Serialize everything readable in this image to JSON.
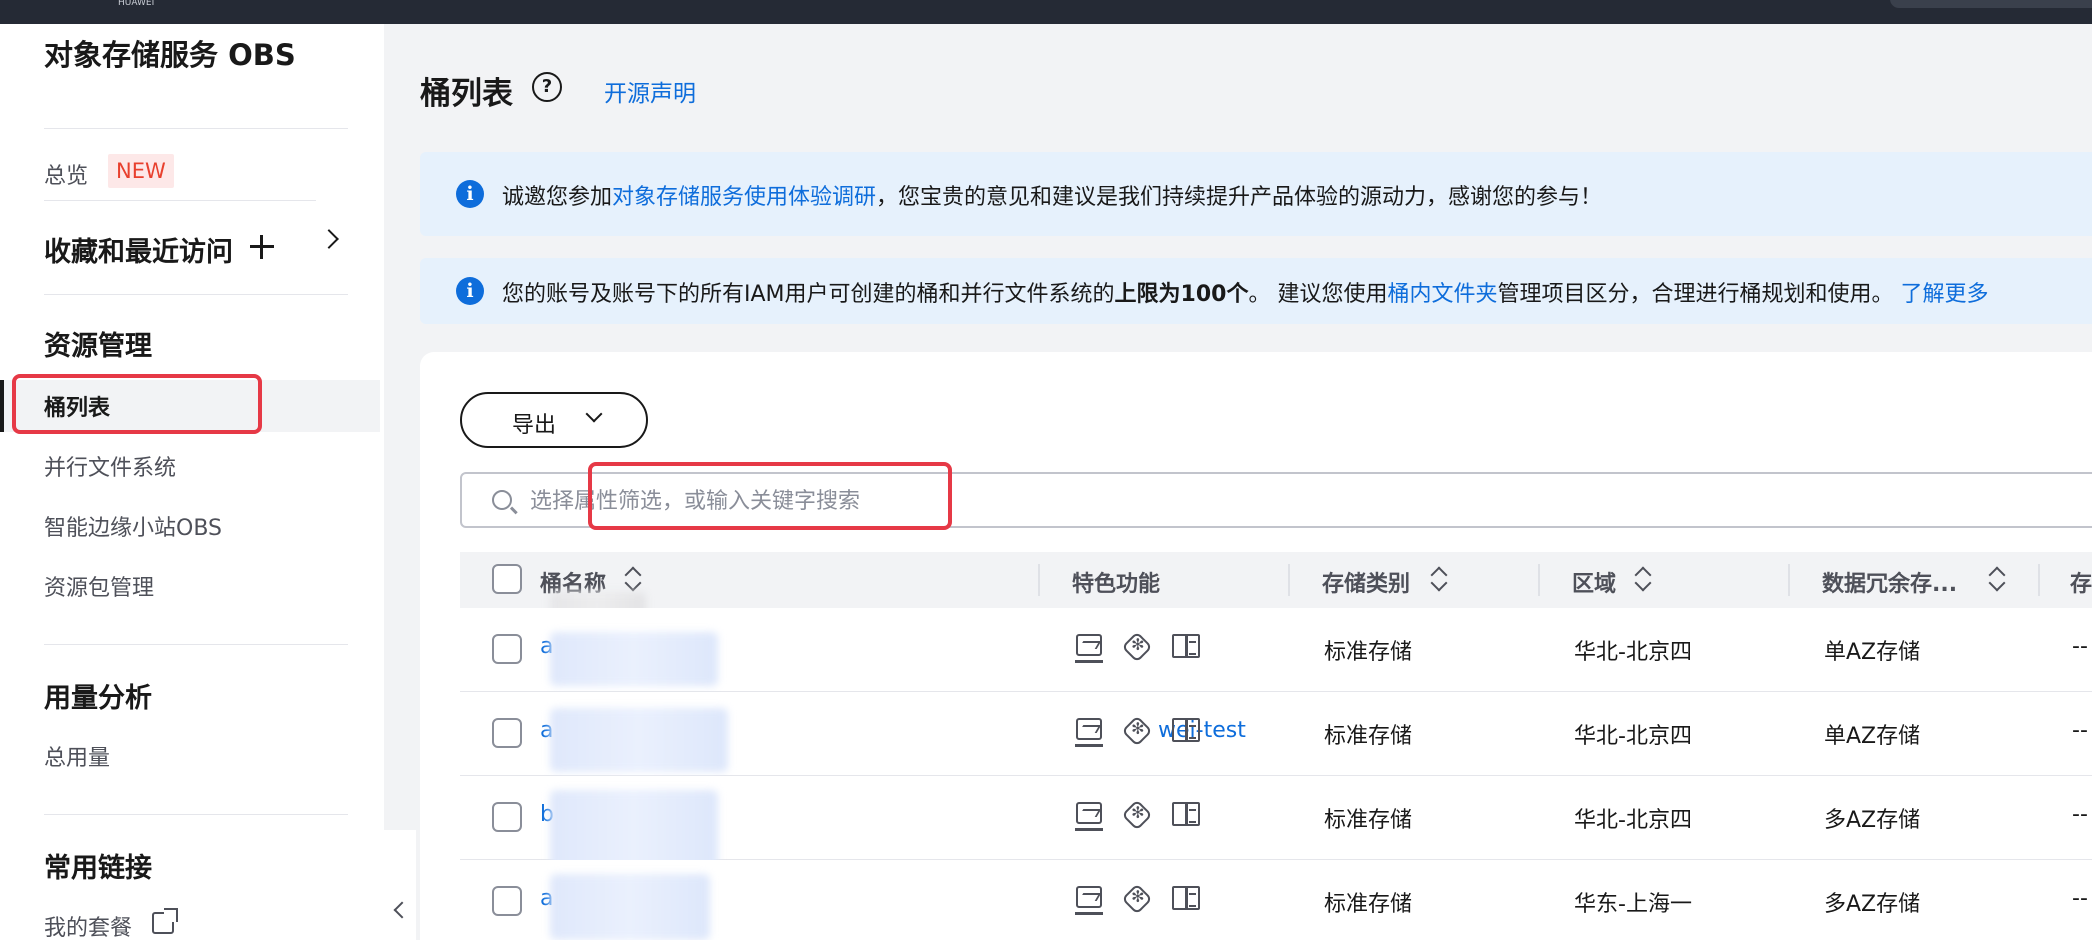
{
  "topbar": {
    "logo_text": "HUAWEI"
  },
  "sidebar": {
    "service_title": "对象存储服务 OBS",
    "overview": "总览",
    "overview_badge": "NEW",
    "favorites": "收藏和最近访问",
    "resource_section": "资源管理",
    "items": {
      "bucket_list": "桶列表",
      "parallel_fs": "并行文件系统",
      "edge_obs": "智能边缘小站OBS",
      "package_mgmt": "资源包管理"
    },
    "usage_section": "用量分析",
    "total_usage": "总用量",
    "links_section": "常用链接",
    "my_package": "我的套餐"
  },
  "main": {
    "title": "桶列表",
    "help_glyph": "?",
    "open_source_link": "开源声明"
  },
  "banners": [
    {
      "icon": "i",
      "pre": "诚邀您参加",
      "link": "对象存储服务使用体验调研",
      "post": "，您宝贵的意见和建议是我们持续提升产品体验的源动力，感谢您的参与！"
    },
    {
      "icon": "i",
      "pre": "您的账号及账号下的所有IAM用户可创建的桶和并行文件系统的",
      "bold": "上限为100个",
      "mid": "。 建议您使用",
      "link": "桶内文件夹",
      "post": "管理项目区分，合理进行桶规划和使用。",
      "link2": "了解更多"
    }
  ],
  "toolbar": {
    "export_label": "导出"
  },
  "search": {
    "placeholder": "选择属性筛选，或输入关键字搜索"
  },
  "table": {
    "headers": {
      "name": "桶名称",
      "features": "特色功能",
      "storage_class": "存储类别",
      "region": "区域",
      "redundancy": "数据冗余存...",
      "next": "存"
    },
    "rows": [
      {
        "name": "a",
        "storage_class": "标准存储",
        "region": "华北-北京四",
        "redundancy": "单AZ存储",
        "next": "--"
      },
      {
        "name": "a",
        "name_suffix": "wei-test",
        "storage_class": "标准存储",
        "region": "华北-北京四",
        "redundancy": "单AZ存储",
        "next": "--"
      },
      {
        "name": "b",
        "storage_class": "标准存储",
        "region": "华北-北京四",
        "redundancy": "多AZ存储",
        "next": "--"
      },
      {
        "name": "a",
        "storage_class": "标准存储",
        "region": "华东-上海一",
        "redundancy": "多AZ存储",
        "next": "--"
      }
    ]
  },
  "colors": {
    "accent": "#0e6ddb",
    "highlight": "#e63946",
    "badge_bg": "#fde8e8",
    "badge_text": "#e8402e",
    "banner_bg": "#e6f1fc"
  }
}
